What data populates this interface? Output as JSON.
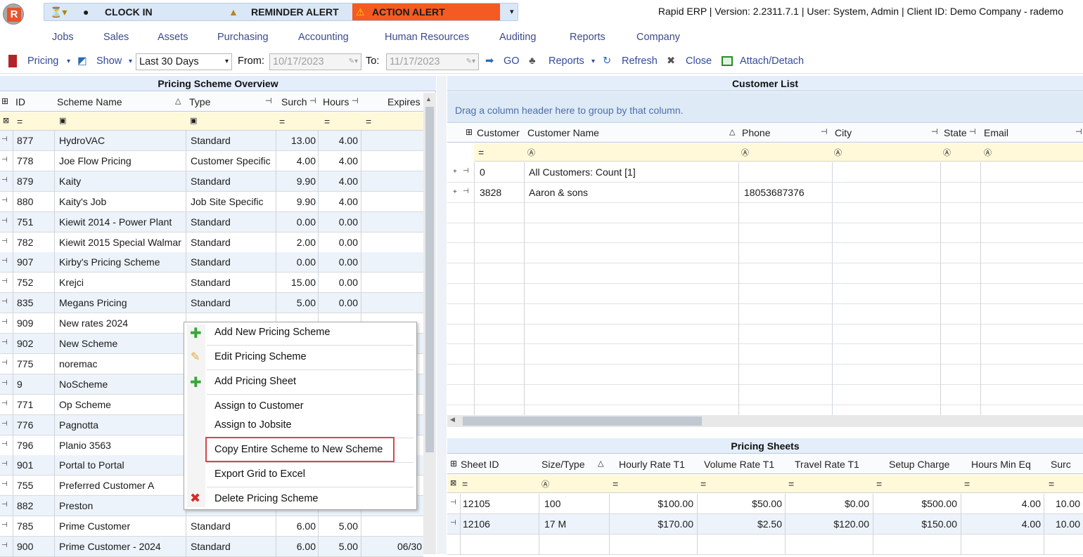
{
  "app": {
    "logo_letter": "R",
    "version_text": "Rapid ERP | Version: 2.2311.7.1 | User: System, Admin | Client ID: Demo Company - rademo"
  },
  "qat": {
    "clock_in": "CLOCK IN",
    "reminder": "REMINDER ALERT",
    "action": "ACTION ALERT",
    "action_color": "#f55a22"
  },
  "menu": [
    "Jobs",
    "Sales",
    "Assets",
    "Purchasing",
    "Accounting",
    "Human Resources",
    "Auditing",
    "Reports",
    "Company"
  ],
  "toolbar": {
    "pricing": "Pricing",
    "show": "Show",
    "range": "Last 30 Days",
    "from_label": "From:",
    "from_value": "10/17/2023",
    "to_label": "To:",
    "to_value": "11/17/2023",
    "go": "GO",
    "reports": "Reports",
    "refresh": "Refresh",
    "close": "Close",
    "attach": "Attach/Detach"
  },
  "left": {
    "title": "Pricing Scheme Overview",
    "columns": [
      "ID",
      "Scheme Name",
      "Type",
      "Surch",
      "Hours",
      "Expires"
    ],
    "rows": [
      [
        "877",
        "HydroVAC",
        "Standard",
        "13.00",
        "4.00",
        ""
      ],
      [
        "778",
        "Joe Flow Pricing",
        "Customer Specific",
        "4.00",
        "4.00",
        ""
      ],
      [
        "879",
        "Kaity",
        "Standard",
        "9.90",
        "4.00",
        ""
      ],
      [
        "880",
        "Kaity's Job",
        "Job Site Specific",
        "9.90",
        "4.00",
        ""
      ],
      [
        "751",
        "Kiewit 2014 - Power Plant",
        "Standard",
        "0.00",
        "0.00",
        ""
      ],
      [
        "782",
        "Kiewit 2015 Special Walmar",
        "Standard",
        "2.00",
        "0.00",
        ""
      ],
      [
        "907",
        "Kirby's Pricing Scheme",
        "Standard",
        "0.00",
        "0.00",
        ""
      ],
      [
        "752",
        "Krejci",
        "Standard",
        "15.00",
        "0.00",
        ""
      ],
      [
        "835",
        "Megans Pricing",
        "Standard",
        "5.00",
        "0.00",
        ""
      ],
      [
        "909",
        "New rates 2024",
        "",
        "",
        "",
        ""
      ],
      [
        "902",
        "New Scheme",
        "",
        "",
        "",
        ""
      ],
      [
        "775",
        "noremac",
        "",
        "",
        "",
        ""
      ],
      [
        "9",
        "NoScheme",
        "",
        "",
        "",
        ""
      ],
      [
        "771",
        "Op Scheme",
        "",
        "",
        "",
        ""
      ],
      [
        "776",
        "Pagnotta",
        "",
        "",
        "",
        ""
      ],
      [
        "796",
        "Planio 3563",
        "",
        "",
        "",
        ""
      ],
      [
        "901",
        "Portal to Portal",
        "",
        "",
        "",
        ""
      ],
      [
        "755",
        "Preferred Customer A",
        "",
        "",
        "",
        ""
      ],
      [
        "882",
        "Preston",
        "",
        "",
        "",
        ""
      ],
      [
        "785",
        "Prime Customer",
        "Standard",
        "6.00",
        "5.00",
        ""
      ],
      [
        "900",
        "Prime Customer - 2024",
        "Standard",
        "6.00",
        "5.00",
        "06/30"
      ]
    ]
  },
  "customers": {
    "title": "Customer List",
    "group_hint": "Drag a column header here to group by that column.",
    "columns": [
      "Customer",
      "Customer Name",
      "Phone",
      "City",
      "State",
      "Email"
    ],
    "rows": [
      [
        "0",
        "All Customers: Count [1]",
        "",
        "",
        "",
        ""
      ],
      [
        "3828",
        "Aaron & sons",
        "18053687376",
        "",
        "",
        ""
      ]
    ]
  },
  "sheets": {
    "title": "Pricing Sheets",
    "columns": [
      "Sheet ID",
      "Size/Type",
      "Hourly Rate T1",
      "Volume Rate T1",
      "Travel Rate T1",
      "Setup Charge",
      "Hours Min Eq",
      "Surc"
    ],
    "rows": [
      [
        "12105",
        "100",
        "$100.00",
        "$50.00",
        "$0.00",
        "$500.00",
        "4.00",
        "10.00"
      ],
      [
        "12106",
        "17 M",
        "$170.00",
        "$2.50",
        "$120.00",
        "$150.00",
        "4.00",
        "10.00"
      ]
    ]
  },
  "context_menu": [
    "Add New Pricing Scheme",
    "Edit Pricing Scheme",
    "Add Pricing Sheet",
    "Assign to Customer",
    "Assign to Jobsite",
    "Copy Entire Scheme to New Scheme",
    "Export Grid to Excel",
    "Delete Pricing Scheme"
  ]
}
